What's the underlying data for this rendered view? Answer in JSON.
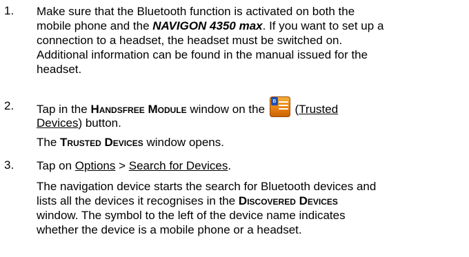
{
  "steps": [
    {
      "number": "1.",
      "lines": [
        [
          "Make sure that the Bluetooth function is activated on both the"
        ],
        [
          "mobile phone and the ",
          "NAVIGON 4350 max",
          ". If you want to set up a"
        ],
        [
          "connection to a headset, the headset must be switched on."
        ],
        [
          "Additional information can be found in the manual issued for the"
        ],
        [
          "headset."
        ]
      ]
    },
    {
      "number": "2.",
      "line1_pre": "Tap in the ",
      "line1_sc": "Handsfree Module",
      "line1_post": " window on the ",
      "line1_paren_open": "(",
      "line1_link": "Trusted",
      "line2_link": "Devices",
      "line2_post": ") button.",
      "icon": "trusted-devices-icon",
      "note_pre": "The ",
      "note_sc": "Trusted Devices",
      "note_post": " window opens."
    },
    {
      "number": "3.",
      "pre": "Tap on ",
      "link1": "Options",
      "sep": " > ",
      "link2": "Search for Devices",
      "end": ".",
      "desc1": "The navigation device starts the search for Bluetooth devices and",
      "desc2_pre": "lists all the devices it recognises in the ",
      "desc2_sc": "Discovered Devices",
      "desc3": "window. The symbol to the left of the device name indicates",
      "desc4": "whether the device is a mobile phone or a headset."
    }
  ]
}
